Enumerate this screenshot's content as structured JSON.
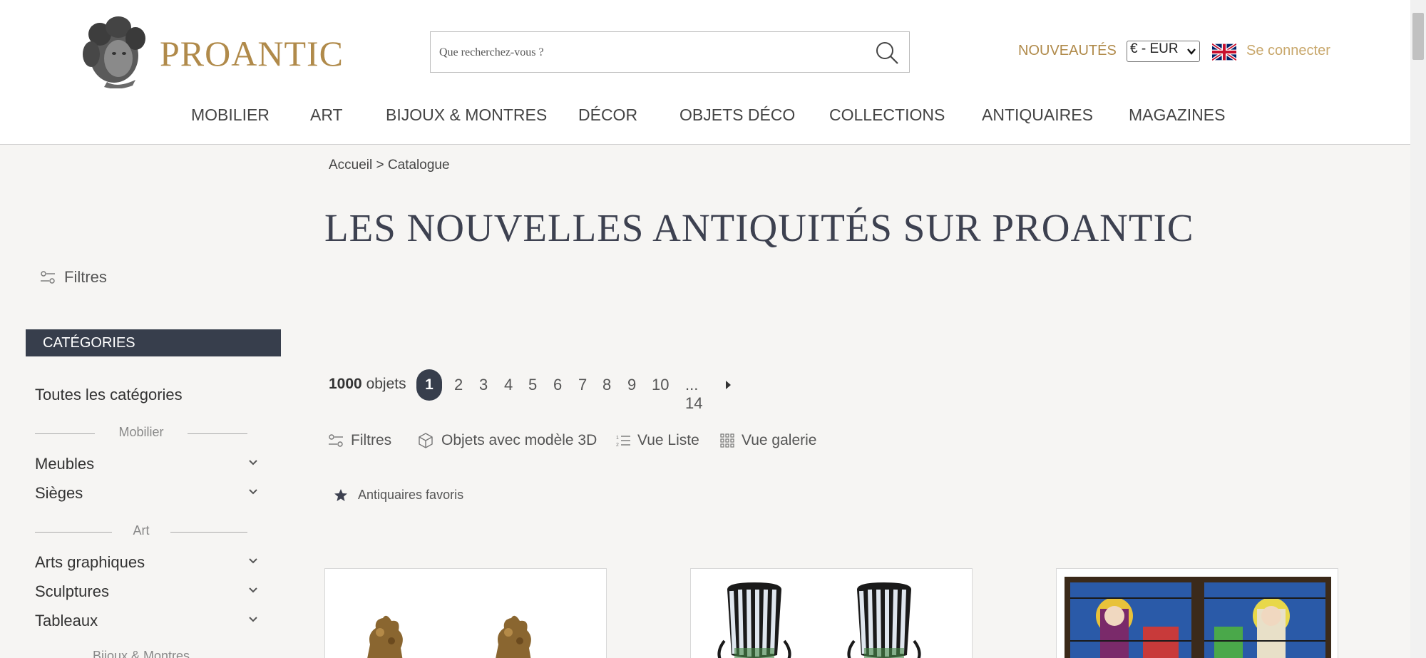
{
  "header": {
    "logo_text": "PROANTIC",
    "search_placeholder": "Que recherchez-vous ?",
    "nouveautes": "NOUVEAUTÉS",
    "currency": "€ - EUR",
    "login": "Se connecter"
  },
  "nav": [
    "MOBILIER",
    "ART",
    "BIJOUX & MONTRES",
    "DÉCOR",
    "OBJETS DÉCO",
    "COLLECTIONS",
    "ANTIQUAIRES",
    "MAGAZINES"
  ],
  "breadcrumb": "Accueil > Catalogue",
  "page_title": "LES NOUVELLES ANTIQUITÉS SUR PROANTIC",
  "sidebar": {
    "filters_label": "Filtres",
    "categories_header": "CATÉGORIES",
    "all_categories": "Toutes les catégories",
    "groups": [
      {
        "title": "Mobilier",
        "items": [
          "Meubles",
          "Sièges"
        ]
      },
      {
        "title": "Art",
        "items": [
          "Arts graphiques",
          "Sculptures",
          "Tableaux"
        ]
      },
      {
        "title": "Bijoux & Montres",
        "items": []
      }
    ]
  },
  "results": {
    "count": "1000",
    "count_label": "objets",
    "pages": [
      "1",
      "2",
      "3",
      "4",
      "5",
      "6",
      "7",
      "8",
      "9",
      "10",
      "... 14"
    ],
    "active_page": "1"
  },
  "toolbar": {
    "filters": "Filtres",
    "objects_3d": "Objets avec modèle 3D",
    "list_view": "Vue Liste",
    "gallery_view": "Vue galerie",
    "favorites": "Antiquaires favoris"
  },
  "colors": {
    "brand_gold": "#b08a4a",
    "dark_navy": "#373e4c",
    "background": "#f6f5f3"
  }
}
